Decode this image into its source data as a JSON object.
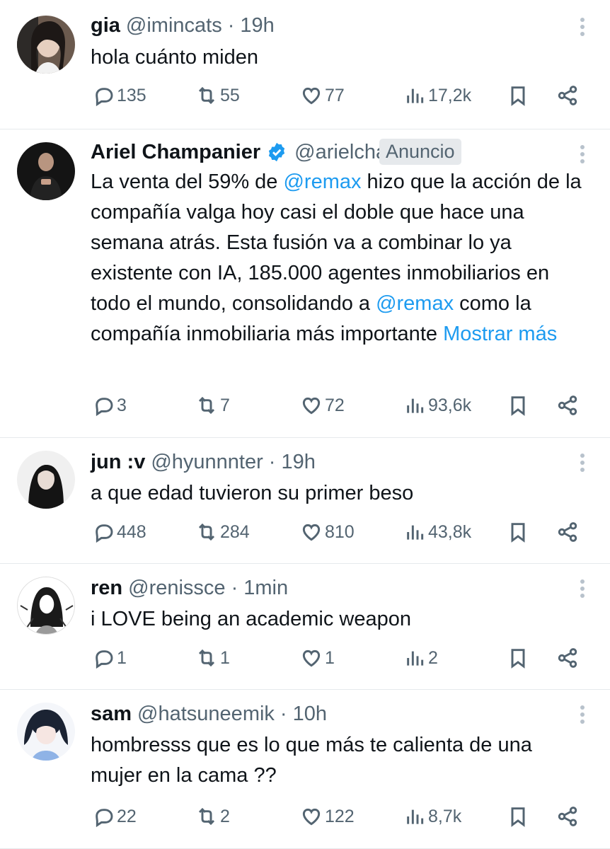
{
  "tweets": [
    {
      "name": "gia",
      "handle": "@imincats",
      "time": "19h",
      "text": "hola cuánto miden",
      "replies": "135",
      "retweets": "55",
      "likes": "77",
      "views": "17,2k"
    },
    {
      "name": "Ariel Champanier",
      "handle": "@arielcham...",
      "badge": "Anuncio",
      "text_1": "La venta del 59% de ",
      "mention_1": "@remax",
      "text_2": " hizo que la acción de la compañía valga hoy casi el doble que hace una semana atrás.  Esta fusión va a combinar lo ya existente con IA, 185.000 agentes inmobiliarios en todo el mundo, consolidando a ",
      "mention_2": "@remax",
      "text_3": "  como la compañía inmobiliaria más importante ",
      "show_more": "Mostrar más",
      "replies": "3",
      "retweets": "7",
      "likes": "72",
      "views": "93,6k"
    },
    {
      "name": "jun :v",
      "handle": "@hyunnnter",
      "time": "19h",
      "text": "a que edad tuvieron su primer beso",
      "replies": "448",
      "retweets": "284",
      "likes": "810",
      "views": "43,8k"
    },
    {
      "name": "ren",
      "handle": "@renissce",
      "time": "1min",
      "text": "i LOVE being an academic weapon",
      "replies": "1",
      "retweets": "1",
      "likes": "1",
      "views": "2"
    },
    {
      "name": "sam",
      "handle": "@hatsuneemik",
      "time": "10h",
      "text": "hombresss que es lo que más te calienta de una mujer en la cama ??",
      "replies": "22",
      "retweets": "2",
      "likes": "122",
      "views": "8,7k"
    }
  ],
  "icons": {
    "reply": "reply-icon",
    "retweet": "retweet-icon",
    "like": "heart-icon",
    "views": "views-icon",
    "bookmark": "bookmark-icon",
    "share": "share-icon",
    "more": "more-icon",
    "verified": "verified-icon"
  },
  "colors": {
    "link": "#1d9bf0",
    "secondary": "#536471",
    "verified": "#1d9bf0"
  }
}
